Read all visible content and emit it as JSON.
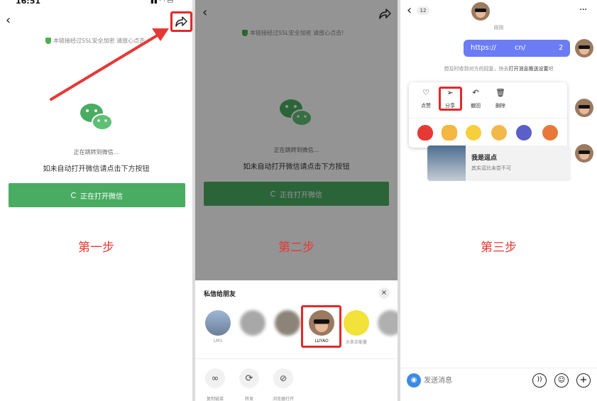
{
  "step1": {
    "status_time": "16:51",
    "ssl_text": "本链接经过SSL安全加密 请放心点击",
    "jump_text": "正在跳转到微信...",
    "hint_text": "如未自动打开微信请点击下方按钮",
    "open_button": "正在打开微信",
    "step_label": "第一步"
  },
  "step2": {
    "ssl_text": "本链接经过SSL安全加密 请放心点击!",
    "jump_text": "正在跳转到微信...",
    "hint_text": "如未自动打开微信请点击下方按钮",
    "open_button": "正在打开微信",
    "step_label": "第二步",
    "sheet_title": "私信给朋友",
    "friends": [
      "LM1",
      "",
      "",
      "LUYAO",
      "头条正能量",
      ""
    ],
    "actions": [
      "复制链接",
      "转发",
      "浏览器打开"
    ]
  },
  "step3": {
    "unread_count": "12",
    "time_label": "刚刚",
    "link_text": "https://",
    "link_mid": "cn/",
    "link_end": "2",
    "notify_text": "想及时收到对方的回复，快去",
    "notify_link": "打开消息推送设置",
    "notify_end": "吧",
    "menu": [
      "点赞",
      "分享",
      "撤回",
      "删除"
    ],
    "card_title": "我是逗点",
    "card_desc": "其实逗比未尝不可",
    "input_placeholder": "发送消息",
    "step_label": "第三步"
  },
  "colors": {
    "brand_green": "#4aac62",
    "highlight_red": "#e02b2b",
    "link_blue": "#6b7cf5"
  }
}
